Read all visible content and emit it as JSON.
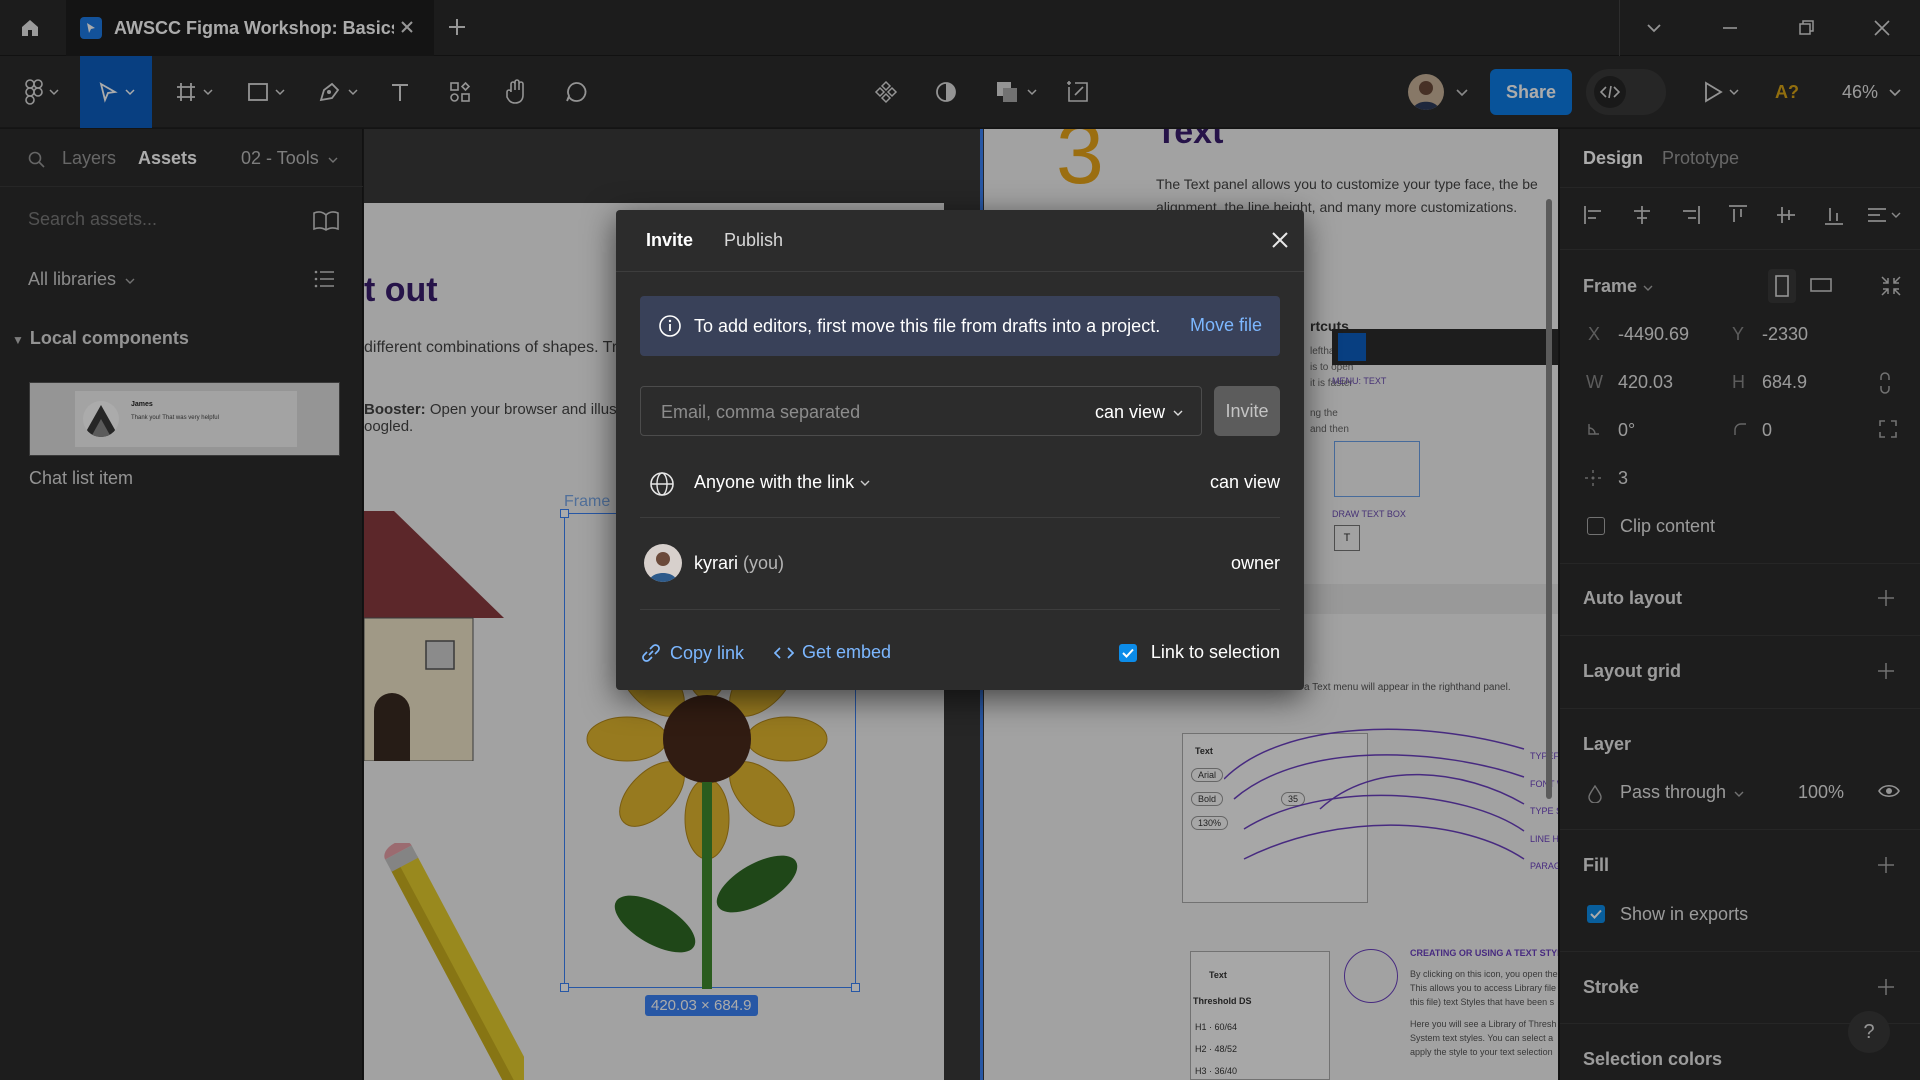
{
  "titlebar": {
    "file_tab_title": "AWSCC Figma Workshop: Basics (C",
    "icons": [
      "home-icon",
      "figma-file-icon",
      "close-icon",
      "plus-icon",
      "chevron-down-icon",
      "minimize-icon",
      "restore-icon",
      "close-icon"
    ]
  },
  "toolbar": {
    "share_label": "Share",
    "spellcheck_label": "A?",
    "zoom_label": "46%"
  },
  "left_panel": {
    "tabs": {
      "layers": "Layers",
      "assets": "Assets"
    },
    "page_selector": "02 - Tools",
    "search_placeholder": "Search assets...",
    "libraries_label": "All libraries",
    "local_components_label": "Local components",
    "component": {
      "name": "Chat list item",
      "preview_name": "James",
      "preview_text": "Thank you! That was very helpful"
    }
  },
  "canvas": {
    "left_page_heading": "t out",
    "left_page_line1": "different combinations of shapes. Try",
    "left_page_booster_bold": "Booster:",
    "left_page_booster_text": " Open your browser and illustra",
    "left_page_booster_text2": "oogled.",
    "frame_label": "Frame",
    "frame_size": "420.03 × 684.9",
    "right_page_number": "3",
    "right_page_title": "Text",
    "right_page_desc1": "The Text panel allows you to customize your type face, the be",
    "right_page_desc2": "alignment, the line height, and many more customizations.",
    "shortcuts_title": "rtcuts",
    "shortcuts_lines": [
      "lefthand",
      "is to open",
      "it is faster",
      "ng the",
      "and then"
    ],
    "menu_text_label": "MENU: TEXT",
    "draw_text_box_label": "DRAW TEXT BOX",
    "text_menu_note": "a Text menu will appear in the righthand panel.",
    "typeface_labels": [
      "TYPEFACE",
      "FONT WEIGHT",
      "TYPE SIZE",
      "LINE HEIGHT",
      "PARAGRAPH A"
    ],
    "text_panel_title": "Text",
    "text_panel_font": "Arial",
    "text_panel_weight": "Bold",
    "text_panel_size": "35",
    "text_panel_lh": "130%",
    "creating_title": "CREATING OR USING A TEXT STYLE",
    "creating_lines": [
      "By clicking on this icon, you open the",
      "This allows you to access Library file",
      "this file) text Styles that have been s",
      "Here you will see a Library of Thresh",
      "System text styles. You can select a",
      "apply the style to your text selection"
    ],
    "threshold_title": "Text",
    "threshold_ds": "Threshold DS",
    "threshold_rows": [
      "H1 · 60/64",
      "H2 · 48/52",
      "H3 · 36/40"
    ]
  },
  "right_panel": {
    "tabs": {
      "design": "Design",
      "prototype": "Prototype"
    },
    "frame_label": "Frame",
    "x_label": "X",
    "x_value": "-4490.69",
    "y_label": "Y",
    "y_value": "-2330",
    "w_label": "W",
    "w_value": "420.03",
    "h_label": "H",
    "h_value": "684.9",
    "rotation_value": "0°",
    "radius_value": "0",
    "corner_smoothing_value": "3",
    "clip_content_label": "Clip content",
    "auto_layout_label": "Auto layout",
    "layout_grid_label": "Layout grid",
    "layer_label": "Layer",
    "blend_mode": "Pass through",
    "opacity": "100%",
    "fill_label": "Fill",
    "show_in_exports_label": "Show in exports",
    "stroke_label": "Stroke",
    "selection_colors_label": "Selection colors",
    "help_label": "?"
  },
  "modal": {
    "tabs": {
      "invite": "Invite",
      "publish": "Publish"
    },
    "banner_text": "To add editors, first move this file from drafts into a project.",
    "banner_action": "Move file",
    "email_placeholder": "Email, comma separated",
    "email_permission": "can view",
    "invite_button": "Invite",
    "link_access_label": "Anyone with the link",
    "link_access_permission": "can view",
    "user_name": "kyrari",
    "user_you": "(you)",
    "user_role": "owner",
    "copy_link": "Copy link",
    "get_embed": "Get embed",
    "link_to_selection": "Link to selection"
  },
  "colors": {
    "accent": "#0c7ce6",
    "banner_bg": "#394159",
    "link_blue": "#7cb7ff",
    "panel_bg": "#2c2c2c",
    "heading_purple": "#3a1d6e"
  }
}
